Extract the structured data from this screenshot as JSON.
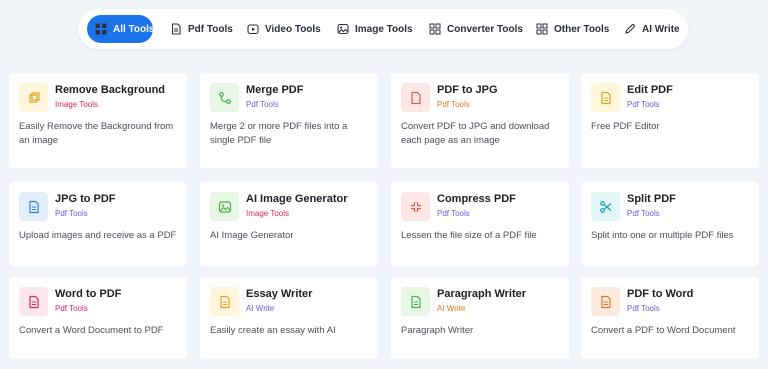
{
  "tabs": [
    {
      "label": "All Tools",
      "active": true,
      "icon": "grid-icon"
    },
    {
      "label": "Pdf Tools",
      "active": false,
      "icon": "pdf-icon"
    },
    {
      "label": "Video Tools",
      "active": false,
      "icon": "video-icon"
    },
    {
      "label": "Image Tools",
      "active": false,
      "icon": "image-icon"
    },
    {
      "label": "Converter Tools",
      "active": false,
      "icon": "grid-icon"
    },
    {
      "label": "Other Tools",
      "active": false,
      "icon": "grid-icon"
    },
    {
      "label": "AI Write",
      "active": false,
      "icon": "pen-icon"
    }
  ],
  "colors": {
    "accent": "#1a73e8",
    "pdf_tools": "#6b5bd2",
    "image_tools": "#d6285b",
    "ai_write": "#e07a1f"
  },
  "cards": [
    {
      "title": "Remove Background",
      "category": "Image Tools",
      "description": "Easily Remove the Background from an image",
      "icon": "crop-icon"
    },
    {
      "title": "Merge PDF",
      "category": "Pdf Tools",
      "description": "Merge 2 or more PDF files into a single PDF file",
      "icon": "merge-icon"
    },
    {
      "title": "PDF to JPG",
      "category": "Pdf Tools",
      "description": "Convert PDF to JPG and download each page as an image",
      "icon": "document-icon"
    },
    {
      "title": "Edit PDF",
      "category": "Pdf Tools",
      "description": "Free PDF Editor",
      "icon": "document-icon"
    },
    {
      "title": "JPG to PDF",
      "category": "Pdf Tools",
      "description": "Upload images and receive as a PDF",
      "icon": "document-icon"
    },
    {
      "title": "AI Image Generator",
      "category": "Image Tools",
      "description": "AI Image Generator",
      "icon": "image-icon"
    },
    {
      "title": "Compress PDF",
      "category": "Pdf Tools",
      "description": "Lessen the file size of a PDF file",
      "icon": "compress-icon"
    },
    {
      "title": "Split PDF",
      "category": "Pdf Tools",
      "description": "Split into one or multiple PDF files",
      "icon": "scissors-icon"
    },
    {
      "title": "Word to PDF",
      "category": "Pdf Tools",
      "description": "Convert a Word Document to PDF",
      "icon": "document-icon"
    },
    {
      "title": "Essay Writer",
      "category": "AI Write",
      "description": "Easily create an essay with AI",
      "icon": "document-icon"
    },
    {
      "title": "Paragraph Writer",
      "category": "AI Write",
      "description": "Paragraph Writer",
      "icon": "document-icon"
    },
    {
      "title": "PDF to Word",
      "category": "Pdf Tools",
      "description": "Convert a PDF to Word Document",
      "icon": "document-icon"
    }
  ]
}
